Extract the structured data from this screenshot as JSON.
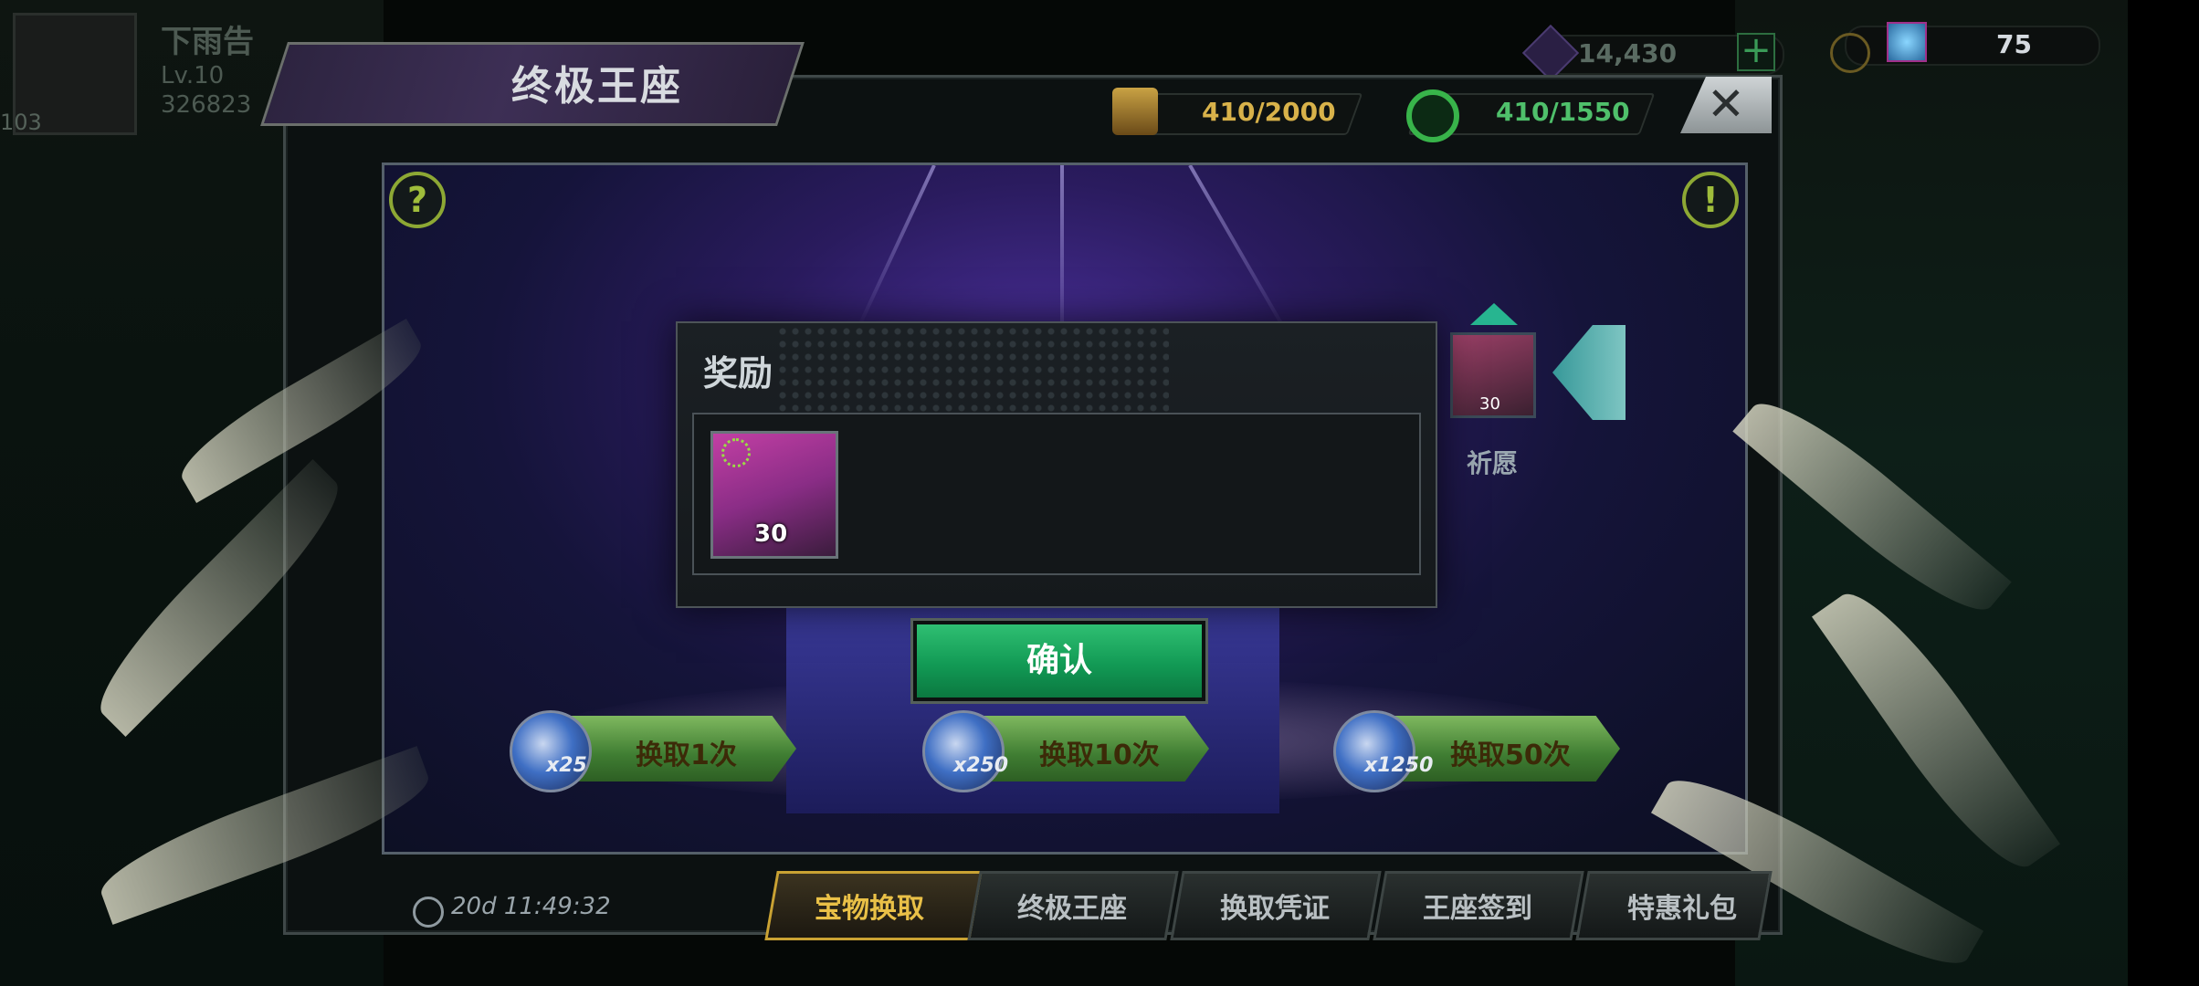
{
  "player": {
    "name": "下雨告",
    "level": "Lv.10",
    "id": "326823",
    "side_number": "103"
  },
  "resources": {
    "gems": "14,430",
    "premium": "75",
    "gold": ""
  },
  "header": {
    "title": "终极王座",
    "counter_left": "410/2000",
    "counter_right": "410/1550"
  },
  "wish": {
    "label": "祈愿",
    "card_count": "30"
  },
  "exchange": [
    {
      "label": "换取1次",
      "cost": "x25"
    },
    {
      "label": "换取10次",
      "cost": "x250"
    },
    {
      "label": "换取50次",
      "cost": "x1250"
    }
  ],
  "modal": {
    "title": "奖励",
    "reward": {
      "count": "30"
    },
    "confirm_label": "确认"
  },
  "timer": "20d 11:49:32",
  "tabs": [
    {
      "label": "宝物换取",
      "active": true
    },
    {
      "label": "终极王座",
      "active": false
    },
    {
      "label": "换取凭证",
      "active": false
    },
    {
      "label": "王座签到",
      "active": false
    },
    {
      "label": "特惠礼包",
      "active": false
    }
  ],
  "colors": {
    "accent_green": "#129a55",
    "gold": "#e9c047",
    "counter_gold": "#d8b24a",
    "counter_green": "#4fc06b"
  }
}
